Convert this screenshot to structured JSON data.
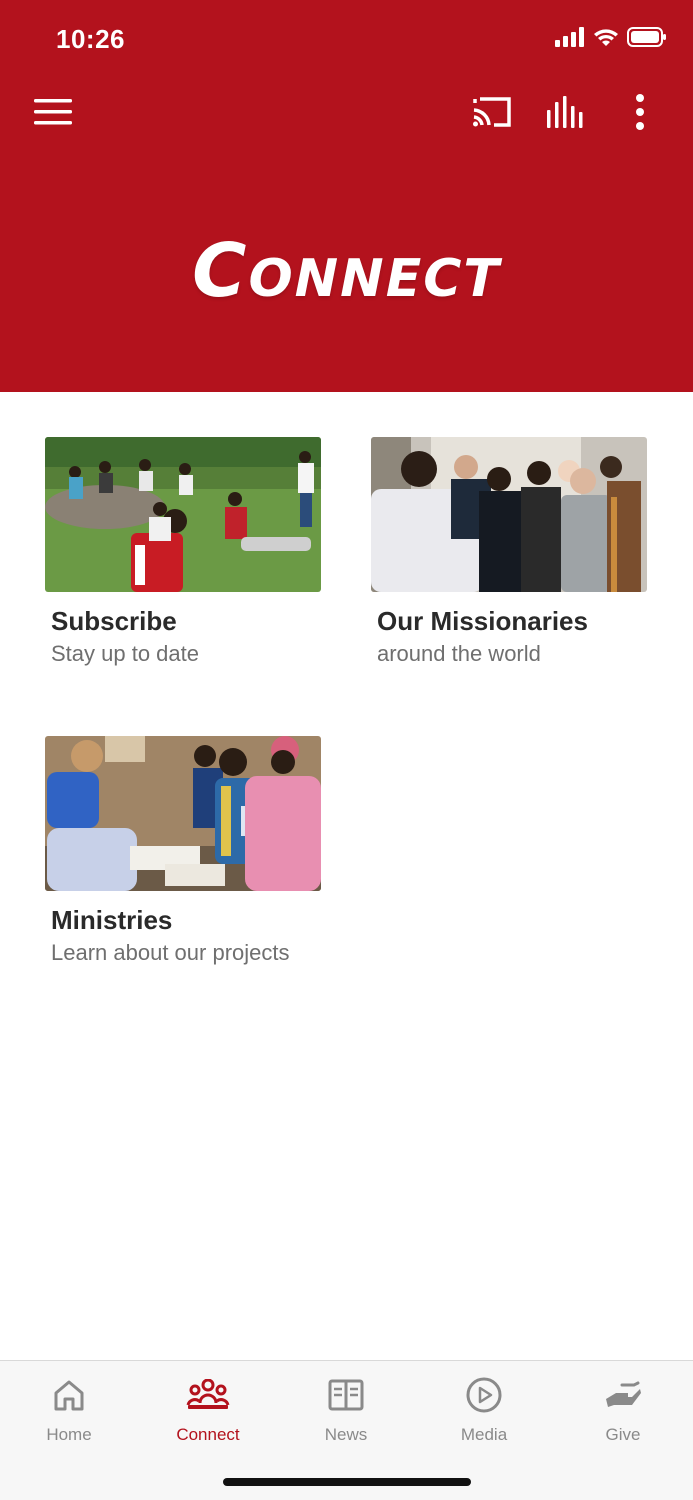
{
  "status": {
    "time": "10:26"
  },
  "header": {
    "title": "Connect"
  },
  "cards": [
    {
      "title": "Subscribe",
      "subtitle": "Stay up to date"
    },
    {
      "title": "Our Missionaries",
      "subtitle": "around the world"
    },
    {
      "title": "Ministries",
      "subtitle": "Learn about our projects"
    }
  ],
  "tabs": [
    {
      "label": "Home",
      "icon": "home-icon"
    },
    {
      "label": "Connect",
      "icon": "people-icon"
    },
    {
      "label": "News",
      "icon": "book-icon"
    },
    {
      "label": "Media",
      "icon": "play-icon"
    },
    {
      "label": "Give",
      "icon": "giving-hand-icon"
    }
  ],
  "colors": {
    "brand": "#b3121d",
    "tab_inactive": "#8a8a8a",
    "text_dark": "#2a2a2a",
    "text_muted": "#6f6f6f"
  }
}
